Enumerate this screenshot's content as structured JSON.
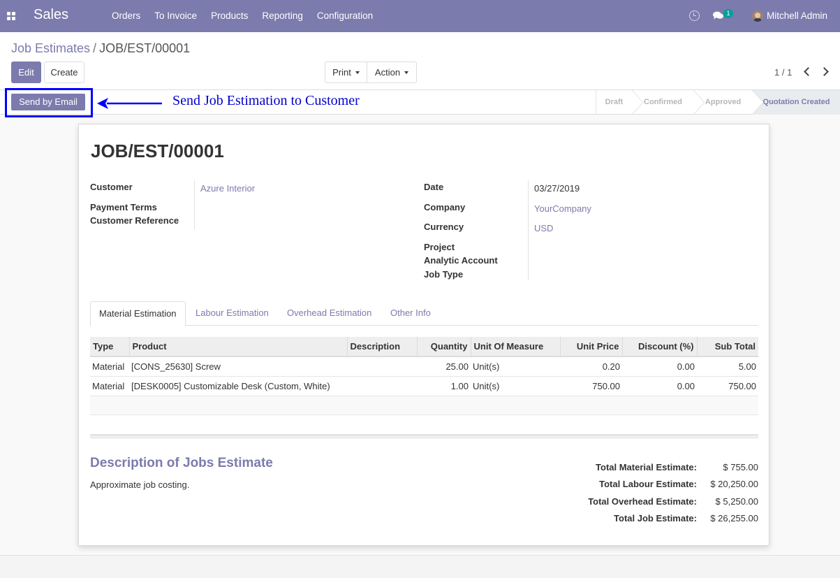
{
  "navbar": {
    "app_name": "Sales",
    "menu": [
      "Orders",
      "To Invoice",
      "Products",
      "Reporting",
      "Configuration"
    ],
    "messages_badge": "1",
    "user_name": "Mitchell Admin",
    "icons": [
      "apps-grid-icon",
      "clock-icon",
      "chat-icon",
      "avatar"
    ]
  },
  "breadcrumb": {
    "parent": "Job Estimates",
    "separator": "/",
    "current": "JOB/EST/00001"
  },
  "buttons": {
    "edit": "Edit",
    "create": "Create",
    "print": "Print",
    "action": "Action",
    "send_email": "Send by Email"
  },
  "pager": {
    "value": "1 / 1"
  },
  "annotation": "Send Job Estimation to Customer",
  "stages": [
    "Draft",
    "Confirmed",
    "Approved",
    "Quotation Created"
  ],
  "active_stage": "Quotation Created",
  "record": {
    "title": "JOB/EST/00001",
    "left_fields": {
      "customer_label": "Customer",
      "customer": "Azure Interior",
      "payment_terms_label": "Payment Terms",
      "customer_ref_label": "Customer Reference"
    },
    "right_fields": {
      "date_label": "Date",
      "date": "03/27/2019",
      "company_label": "Company",
      "company": "YourCompany",
      "currency_label": "Currency",
      "currency": "USD",
      "project_label": "Project",
      "analytic_label": "Analytic Account",
      "job_type_label": "Job Type"
    }
  },
  "tabs": [
    "Material Estimation",
    "Labour Estimation",
    "Overhead Estimation",
    "Other Info"
  ],
  "active_tab": "Material Estimation",
  "table": {
    "headers": [
      "Type",
      "Product",
      "Description",
      "Quantity",
      "Unit Of Measure",
      "Unit Price",
      "Discount (%)",
      "Sub Total"
    ],
    "rows": [
      [
        "Material",
        "[CONS_25630] Screw",
        "",
        "25.00",
        "Unit(s)",
        "0.20",
        "0.00",
        "5.00"
      ],
      [
        "Material",
        "[DESK0005] Customizable Desk (Custom, White)",
        "",
        "1.00",
        "Unit(s)",
        "750.00",
        "0.00",
        "750.00"
      ]
    ]
  },
  "description": {
    "title": "Description of Jobs Estimate",
    "text": "Approximate job costing."
  },
  "totals": [
    {
      "label": "Total Material Estimate:",
      "value": "$ 755.00"
    },
    {
      "label": "Total Labour Estimate:",
      "value": "$ 20,250.00"
    },
    {
      "label": "Total Overhead Estimate:",
      "value": "$ 5,250.00"
    },
    {
      "label": "Total Job Estimate:",
      "value": "$ 26,255.00"
    }
  ],
  "colors": {
    "brand": "#7c7bad",
    "annotation": "#0000ff",
    "badge": "#00a09d"
  }
}
